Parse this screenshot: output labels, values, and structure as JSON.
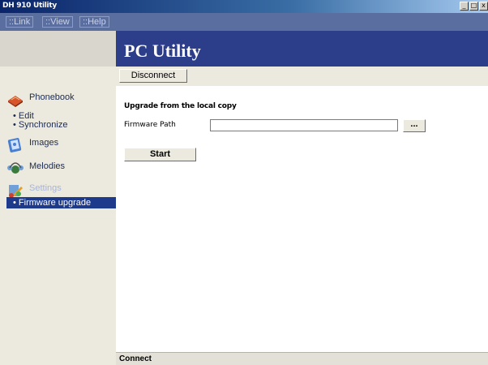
{
  "window": {
    "title": "DH 910 Utility",
    "controls": [
      "_",
      "□",
      "x"
    ]
  },
  "menu": {
    "items": [
      {
        "label": "::Link"
      },
      {
        "label": "::View"
      },
      {
        "label": "::Help"
      }
    ]
  },
  "header": {
    "title": "PC Utility"
  },
  "toolbar": {
    "disconnect_label": "Disconnect"
  },
  "sidebar": {
    "phonebook": {
      "label": "Phonebook",
      "icon": "phonebook-icon",
      "subitems": [
        "• Edit",
        "• Synchronize"
      ]
    },
    "images": {
      "label": "Images",
      "icon": "images-icon"
    },
    "melodies": {
      "label": "Melodies",
      "icon": "melodies-icon"
    },
    "settings": {
      "label": "Settings",
      "icon": "settings-icon",
      "subitems": [
        "• Firmware upgrade"
      ]
    }
  },
  "main": {
    "section_title": "Upgrade from the local copy",
    "firmware_path_label": "Firmware Path",
    "firmware_path_value": "",
    "browse_label": "...",
    "start_label": "Start"
  },
  "status": {
    "text": "Connect"
  },
  "colors": {
    "header_bg": "#2c3e8a",
    "selected_bg": "#1e3a8a",
    "menubar_bg": "#5b6ea0"
  }
}
